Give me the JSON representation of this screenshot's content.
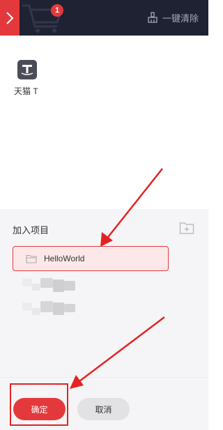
{
  "header": {
    "cart_badge_count": "1",
    "clear_all_label": "一键清除",
    "background_color": "#1f2233",
    "accent_color": "#e4393c"
  },
  "shop": {
    "label": "天猫 T",
    "icon": "tmall-icon"
  },
  "project_panel": {
    "title": "加入项目",
    "new_folder_icon": "folder-plus-icon",
    "items": [
      {
        "label": "HelloWorld",
        "selected": true,
        "icon": "folder-icon"
      }
    ]
  },
  "footer": {
    "confirm_label": "确定",
    "cancel_label": "取消"
  },
  "annotations": {
    "arrow_color": "#e52222",
    "highlight_color": "#e52222"
  }
}
